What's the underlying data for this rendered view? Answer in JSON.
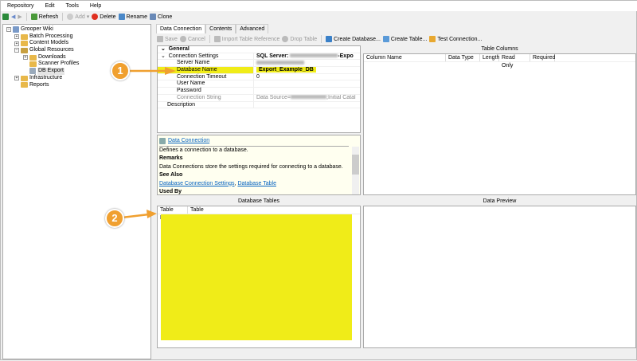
{
  "menu": [
    "Repository",
    "Edit",
    "Tools",
    "Help"
  ],
  "toolbar": {
    "refresh": "Refresh",
    "add": "Add",
    "delete": "Delete",
    "rename": "Rename",
    "clone": "Clone"
  },
  "tree": {
    "root": "Grooper Wiki",
    "items": [
      "Batch Processing",
      "Content Models",
      "Global Resources",
      "Downloads",
      "Scanner Profiles",
      "DB Export",
      "Infrastructure",
      "Reports"
    ]
  },
  "tabs": [
    "Data Connection",
    "Contents",
    "Advanced"
  ],
  "subtoolbar": {
    "save": "Save",
    "cancel": "Cancel",
    "import": "Import Table Reference",
    "drop": "Drop Table",
    "create_db": "Create Database...",
    "create_table": "Create Table...",
    "test": "Test Connection..."
  },
  "properties": {
    "general": "General",
    "connection_settings": "Connection Settings",
    "connection_settings_value": "SQL Server:",
    "connection_settings_suffix": "-Expo",
    "server_name": "Server Name",
    "database_name": "Database Name",
    "database_name_value": "Export_Example_DB",
    "timeout": "Connection Timeout",
    "timeout_value": "0",
    "user": "User Name",
    "password": "Password",
    "conn_string": "Connection String",
    "conn_string_value": "Data Source=",
    "conn_string_suffix": ";Initial Catal",
    "description": "Description"
  },
  "help": {
    "title": "Data Connection",
    "summary": "Defines a connection to a database.",
    "remarks_h": "Remarks",
    "remarks": "Data Connections store the settings required for connecting to a database.",
    "see_also_h": "See Also",
    "link1": "Database Connection Settings",
    "link2": "Database Table",
    "used_by_h": "Used By"
  },
  "table_columns": {
    "title": "Table Columns",
    "headers": [
      "Column Name",
      "Data Type",
      "Length",
      "Read Only",
      "Required"
    ]
  },
  "database_tables": {
    "title": "Database Tables",
    "headers": [
      "Table Name",
      "Table Schema"
    ]
  },
  "data_preview": {
    "title": "Data Preview"
  },
  "callouts": [
    "1",
    "2"
  ],
  "colors": {
    "highlight": "#f0ec18",
    "callout": "#f0a030"
  }
}
